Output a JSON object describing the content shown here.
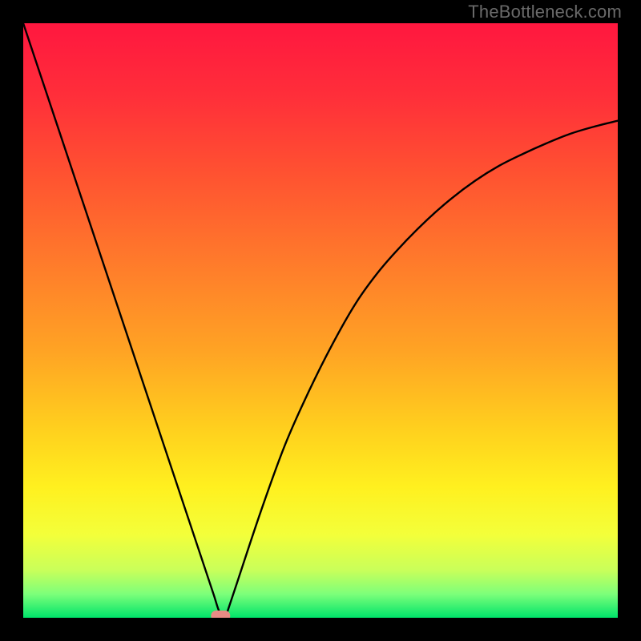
{
  "watermark": "TheBottleneck.com",
  "chart_data": {
    "type": "line",
    "title": "",
    "xlabel": "",
    "ylabel": "",
    "xlim": [
      0,
      100
    ],
    "ylim": [
      0,
      100
    ],
    "x": [
      0,
      4,
      8,
      12,
      16,
      20,
      24,
      28,
      30,
      32,
      33,
      34,
      36,
      40,
      44,
      48,
      52,
      56,
      60,
      64,
      68,
      72,
      76,
      80,
      84,
      88,
      92,
      96,
      100
    ],
    "values": [
      100,
      88,
      76,
      64,
      52,
      40,
      28,
      16,
      10,
      4,
      1,
      0,
      6,
      18,
      29,
      38,
      46,
      53,
      58.5,
      63,
      67,
      70.5,
      73.5,
      76,
      78,
      79.8,
      81.4,
      82.6,
      83.6
    ],
    "notch_x": 34,
    "marker": {
      "x": 33.2,
      "y": 0
    },
    "background_gradient": {
      "stops": [
        {
          "offset": 0.0,
          "color": "#ff173f"
        },
        {
          "offset": 0.12,
          "color": "#ff2e3a"
        },
        {
          "offset": 0.25,
          "color": "#ff5131"
        },
        {
          "offset": 0.4,
          "color": "#ff7a2b"
        },
        {
          "offset": 0.55,
          "color": "#ffa324"
        },
        {
          "offset": 0.68,
          "color": "#ffcf1e"
        },
        {
          "offset": 0.78,
          "color": "#fff01f"
        },
        {
          "offset": 0.86,
          "color": "#f3ff3a"
        },
        {
          "offset": 0.92,
          "color": "#c9ff5a"
        },
        {
          "offset": 0.96,
          "color": "#7dff7a"
        },
        {
          "offset": 1.0,
          "color": "#00e46a"
        }
      ]
    }
  }
}
